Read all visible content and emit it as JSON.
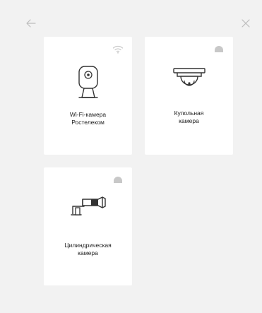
{
  "header": {
    "back_icon": "arrow-left-icon",
    "close_icon": "close-icon"
  },
  "cameras": [
    {
      "line1": "Wi-Fi-камера",
      "line2": "Ростелеком",
      "badge_icon": "wifi-icon",
      "illustration_icon": "wifi-camera-icon"
    },
    {
      "line1": "Купольная",
      "line2": "камера",
      "badge_icon": "dome-badge-icon",
      "illustration_icon": "dome-camera-icon"
    },
    {
      "line1": "Цилиндрическая",
      "line2": "камера",
      "badge_icon": "dome-badge-icon",
      "illustration_icon": "bullet-camera-icon"
    }
  ],
  "colors": {
    "background": "#f2f2f2",
    "card": "#ffffff",
    "icon_muted": "#c8c8c8",
    "icon_dark": "#333333",
    "text": "#1a1a1a"
  }
}
